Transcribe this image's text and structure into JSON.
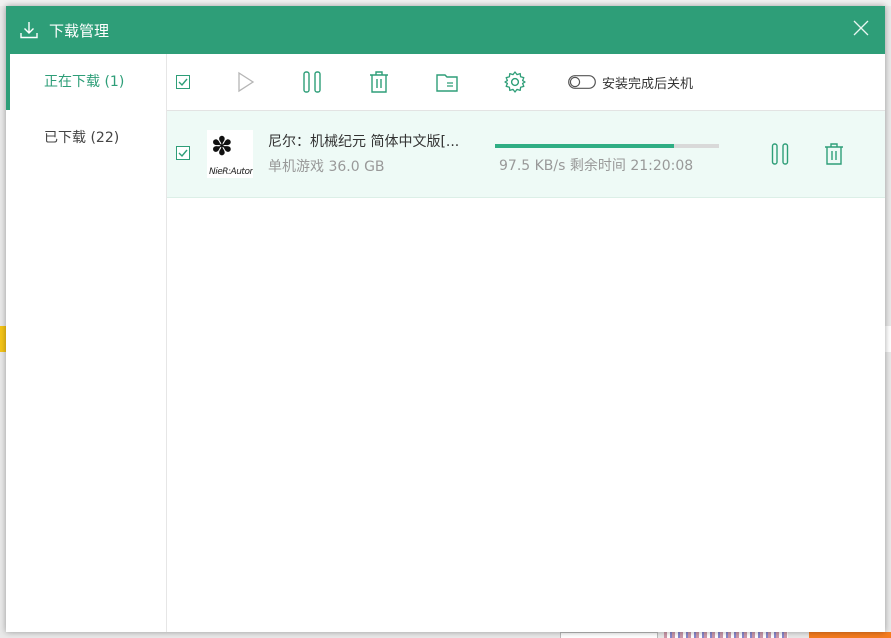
{
  "dialog": {
    "title": "下载管理",
    "accent_color": "#2e9e78"
  },
  "sidebar": {
    "items": [
      {
        "label": "正在下载 (1)",
        "active": true
      },
      {
        "label": "已下载 (22)",
        "active": false
      }
    ]
  },
  "toolbar": {
    "icons": [
      "select-all-checkbox",
      "start-icon",
      "pause-icon",
      "delete-icon",
      "open-folder-icon",
      "settings-icon",
      "toggle-switch"
    ],
    "shutdown_toggle_label": "安装完成后关机",
    "shutdown_toggle_on": false
  },
  "downloads": [
    {
      "name": "尼尔：机械纪元  简体中文版[...",
      "category": "单机游戏",
      "size": "36.0 GB",
      "meta": "单机游戏  36.0 GB",
      "speed_text": "97.5 KB/s 剩余时间 21:20:08",
      "progress": 0.8,
      "checked": true,
      "thumbnail_text": "NieR:Automata"
    }
  ]
}
